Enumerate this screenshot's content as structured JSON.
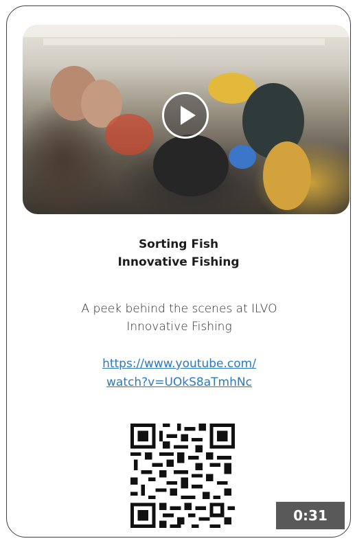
{
  "video": {
    "play_icon": "play-icon",
    "duration": "0:31"
  },
  "title": {
    "line1": "Sorting Fish",
    "line2": "Innovative Fishing"
  },
  "description": {
    "line1": "A peek behind the scenes at ILVO",
    "line2": "Innovative Fishing"
  },
  "link": {
    "line1": "https://www.youtube.com/",
    "line2": "watch?v=UOkS8aTmhNc"
  },
  "qr": {
    "icon": "qr-code-icon"
  },
  "colors": {
    "link": "#2b78c2",
    "duration_bg": "#595959",
    "card_border": "#3d3d3d"
  }
}
